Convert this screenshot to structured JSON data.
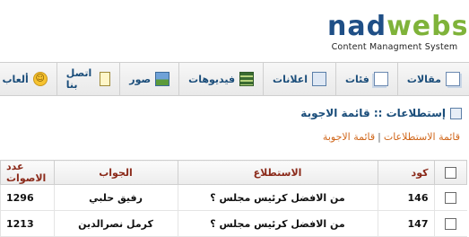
{
  "logo": {
    "part1": "nad",
    "part2": "webs",
    "tagline": "Content Managment System"
  },
  "menu": [
    {
      "key": "articles",
      "label": "مقالات",
      "icon": "articles-icon"
    },
    {
      "key": "categories",
      "label": "فئات",
      "icon": "categories-icon"
    },
    {
      "key": "ads",
      "label": "اعلانات",
      "icon": "ads-icon"
    },
    {
      "key": "videos",
      "label": "فيديوهات",
      "icon": "film-icon"
    },
    {
      "key": "photos",
      "label": "صور",
      "icon": "image-icon"
    },
    {
      "key": "contact",
      "label": "اتصل بنا",
      "icon": "contact-icon"
    },
    {
      "key": "games",
      "label": "ألعاب",
      "icon": "smiley-icon"
    }
  ],
  "page": {
    "title": "إستطلاعات :: قائمة الاجوبة"
  },
  "breadcrumb": {
    "first": "قائمة الاستطلاعات",
    "separator": "|",
    "second": "قائمة الاجوبة"
  },
  "table": {
    "headers": {
      "code": "كود",
      "poll": "الاستطلاع",
      "answer": "الجواب",
      "votes": "عدد الاصوات"
    },
    "rows": [
      {
        "code": "146",
        "poll": "من الافضل كرئيس مجلس ؟",
        "answer": "رفيق حلبي",
        "votes": "1296"
      },
      {
        "code": "147",
        "poll": "من الافضل كرئيس مجلس ؟",
        "answer": "كرمل نصرالدين",
        "votes": "1213"
      }
    ]
  }
}
